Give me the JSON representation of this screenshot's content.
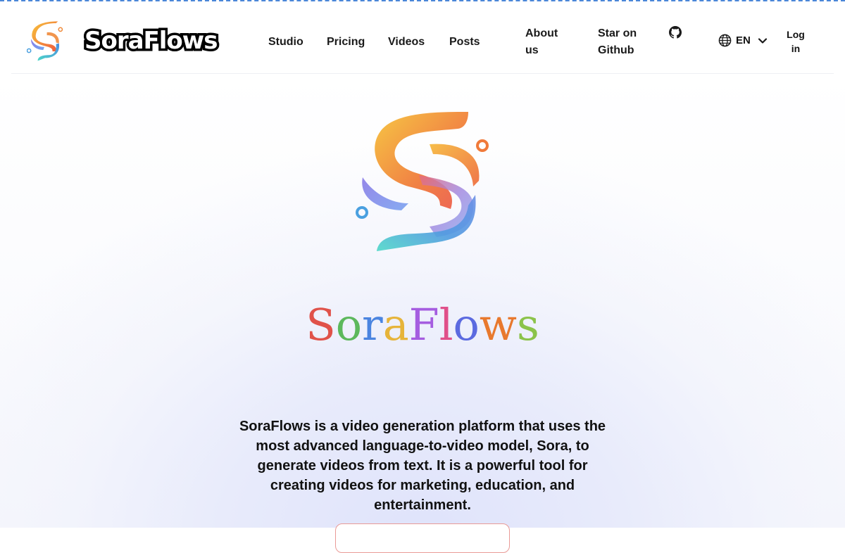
{
  "header": {
    "brand": "SoraFlows",
    "nav": {
      "studio": "Studio",
      "pricing": "Pricing",
      "videos": "Videos",
      "posts": "Posts",
      "about": "About us",
      "star": "Star on Github"
    },
    "github_icon": "github-icon",
    "language": {
      "icon": "globe-icon",
      "code": "EN",
      "chevron": "chevron-down-icon"
    },
    "login": "Log in"
  },
  "hero": {
    "title_letters": [
      {
        "ch": "S",
        "color": "#e0524a"
      },
      {
        "ch": "o",
        "color": "#5cb85c"
      },
      {
        "ch": "r",
        "color": "#4a84e0"
      },
      {
        "ch": "a",
        "color": "#e6b43a"
      },
      {
        "ch": "F",
        "color": "#a55de0"
      },
      {
        "ch": "l",
        "color": "#e0508a"
      },
      {
        "ch": "o",
        "color": "#5b6ae0"
      },
      {
        "ch": "w",
        "color": "#e8792e"
      },
      {
        "ch": "s",
        "color": "#8bc34a"
      }
    ],
    "description": "SoraFlows is a video generation platform that uses the most advanced language-to-video model, Sora, to generate videos from text. It is a powerful tool for creating videos for marketing, education, and entertainment."
  },
  "colors": {
    "accent_dash": "#4a86d8",
    "cta_border": "#e99a96"
  }
}
